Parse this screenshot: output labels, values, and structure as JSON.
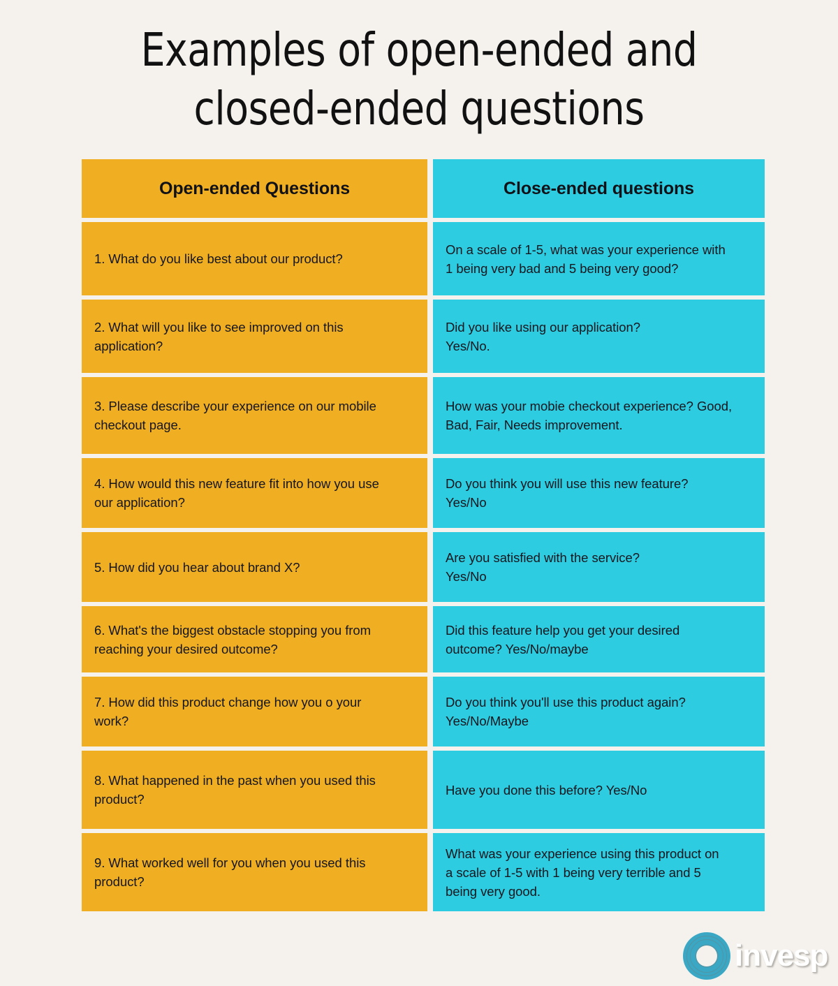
{
  "page": {
    "background_color": "#f5f2ee",
    "title_lines": [
      "Examples of open-ended and",
      "closed-ended questions"
    ]
  },
  "colors": {
    "open_ended_cell": "#f0ae22",
    "closed_ended_cell": "#2ecce0",
    "text": "#15161e",
    "background": "#f5f2ee",
    "logo_mark": "#3aa8c4",
    "logo_text": "#ffffff"
  },
  "table": {
    "headers": {
      "left": "Open-ended Questions",
      "right": "Close-ended questions"
    },
    "rows": [
      {
        "open": "1. What do you like best about our product?",
        "closed": "On a scale of 1-5, what was your experience with\n1 being very bad and 5 being very good?"
      },
      {
        "open": "2. What will you like to see improved on this\napplication?",
        "closed": "Did you like using our application?\nYes/No."
      },
      {
        "open": "3. Please describe your experience on our mobile\ncheckout page.",
        "closed": "How was your mobie checkout experience? Good,\nBad, Fair, Needs improvement."
      },
      {
        "open": "4. How would this new feature fit into how you use\nour application?",
        "closed": "Do you think you will use this new feature?\nYes/No"
      },
      {
        "open": "5. How did you hear about brand X?",
        "closed": "Are you satisfied with the service?\nYes/No"
      },
      {
        "open": "6. What's the biggest obstacle stopping you from\nreaching your desired outcome?",
        "closed": "Did this feature help you get your desired\noutcome? Yes/No/maybe"
      },
      {
        "open": "7. How did this product change how you o your\nwork?",
        "closed": "Do you think you'll use this product again?\nYes/No/Maybe"
      },
      {
        "open": "8. What happened in the past when you used this\nproduct?",
        "closed": "Have you done this before? Yes/No"
      },
      {
        "open": "9. What worked well for you when you used this\nproduct?",
        "closed": "What was your experience using this product on\na scale of 1-5 with 1 being very terrible and 5\nbeing very good."
      }
    ]
  },
  "logo": {
    "name": "invesp",
    "icon": "concentric-ring-icon"
  }
}
